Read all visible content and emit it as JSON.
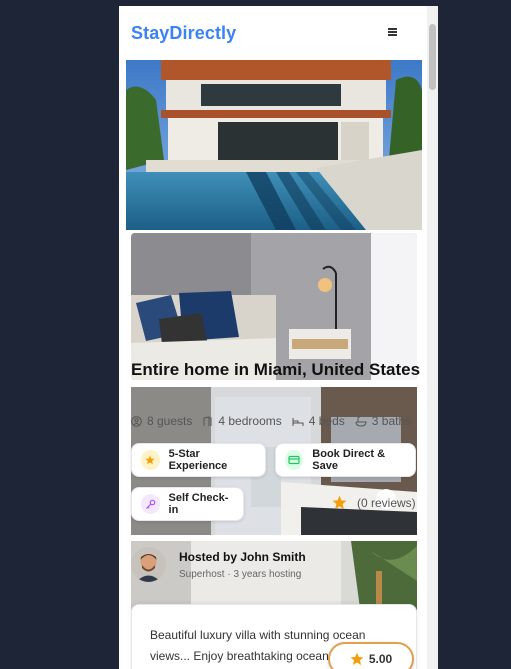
{
  "header": {
    "logo": "StayDirectly",
    "menu_icon": "hamburger-icon"
  },
  "listing": {
    "title": "Entire home in Miami, United States",
    "stats": [
      {
        "icon": "guests-icon",
        "label": "8 guests"
      },
      {
        "icon": "bedrooms-icon",
        "label": "4 bedrooms"
      },
      {
        "icon": "beds-icon",
        "label": "4 beds"
      },
      {
        "icon": "baths-icon",
        "label": "3 baths"
      }
    ],
    "badges": [
      {
        "icon": "star-icon",
        "label": "5-Star Experience",
        "color": "#f59e0b"
      },
      {
        "icon": "card-icon",
        "label": "Book Direct & Save",
        "color": "#22c55e"
      },
      {
        "icon": "key-icon",
        "label": "Self Check-in",
        "color": "#a855f7"
      }
    ],
    "reviews": "(0 reviews)",
    "rating": "5.00"
  },
  "host": {
    "name": "Hosted by John Smith",
    "subtitle": "Superhost · 3 years hosting"
  },
  "description": "Beautiful luxury villa with stunning ocean views... Enjoy breathtaking ocean"
}
